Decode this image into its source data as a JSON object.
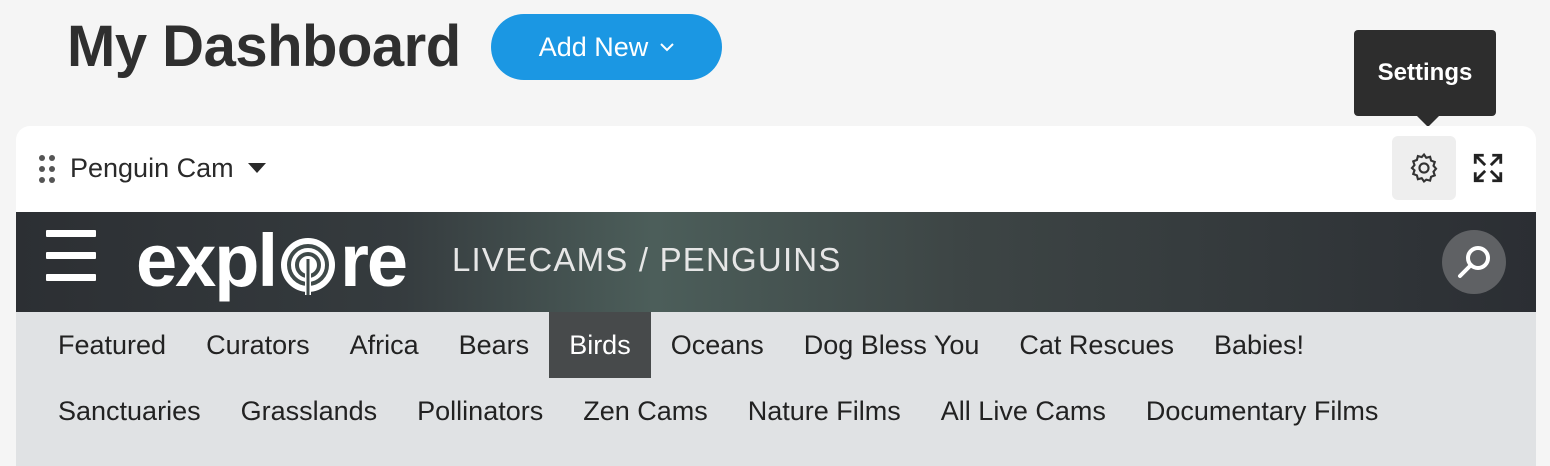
{
  "page": {
    "title": "My Dashboard",
    "add_new_label": "Add New"
  },
  "tooltip": {
    "text": "Settings"
  },
  "widget": {
    "title": "Penguin Cam",
    "icons": {
      "drag": "drag-handle-icon",
      "settings": "gear-icon",
      "expand": "expand-icon",
      "dropdown": "caret-down-icon"
    }
  },
  "site": {
    "logo": "explore",
    "breadcrumb": "LIVECAMS / PENGUINS",
    "icons": {
      "menu": "hamburger-icon",
      "search": "search-icon"
    },
    "nav_row1": [
      "Featured",
      "Curators",
      "Africa",
      "Bears",
      "Birds",
      "Oceans",
      "Dog Bless You",
      "Cat Rescues",
      "Babies!"
    ],
    "nav_row2": [
      "Sanctuaries",
      "Grasslands",
      "Pollinators",
      "Zen Cams",
      "Nature Films",
      "All Live Cams",
      "Documentary Films"
    ],
    "active_nav": "Birds"
  },
  "colors": {
    "accent": "#1b97e3",
    "tooltip_bg": "#2d2d2d",
    "nav_active_bg": "#474a4b"
  }
}
